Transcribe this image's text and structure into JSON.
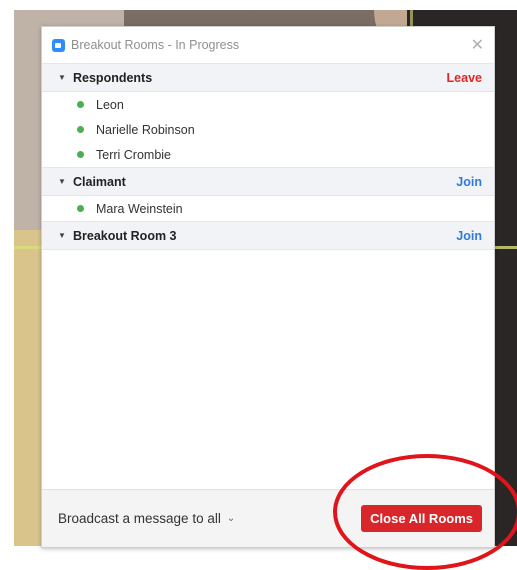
{
  "window": {
    "title": "Breakout Rooms - In Progress",
    "close_glyph": "✕"
  },
  "rooms": [
    {
      "name": "Respondents",
      "action": "Leave",
      "participants": [
        "Leon",
        "Narielle Robinson",
        "Terri Crombie"
      ]
    },
    {
      "name": "Claimant",
      "action": "Join",
      "participants": [
        "Mara Weinstein"
      ]
    },
    {
      "name": "Breakout Room 3",
      "action": "Join",
      "participants": []
    }
  ],
  "footer": {
    "broadcast_label": "Broadcast a message to all",
    "chevron": "⌄",
    "close_all_label": "Close All Rooms"
  },
  "colors": {
    "leave": "#e02828",
    "join": "#2d7be0",
    "close_all": "#d9262a",
    "online": "#4caf50",
    "annotation": "#e0141b"
  },
  "icons": {
    "app": "zoom-logo-icon",
    "caret": "triangle-down-icon",
    "close": "close-icon",
    "status": "green-dot-icon"
  }
}
